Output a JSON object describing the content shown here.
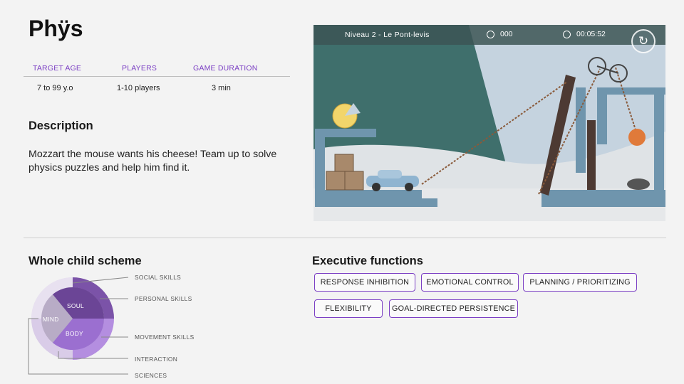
{
  "app": {
    "title": "Phÿs"
  },
  "info": {
    "headers": [
      "TARGET AGE",
      "PLAYERS",
      "GAME DURATION"
    ],
    "values": [
      "7 to 99  y.o",
      "1-10 players",
      "3 min"
    ]
  },
  "description": {
    "heading": "Description",
    "text": "Mozzart the mouse wants his cheese! Team up to solve physics puzzles and help him find it."
  },
  "game": {
    "level": "Niveau 2 - Le Pont-levis",
    "score": "000",
    "timer": "00:05:52",
    "icons": [
      "ball-icon",
      "stopwatch-icon",
      "restart-icon"
    ]
  },
  "whole_child": {
    "heading": "Whole child scheme",
    "center_labels": [
      "SOUL",
      "MIND",
      "BODY"
    ],
    "callouts": [
      "SOCIAL SKILLS",
      "PERSONAL SKILLS",
      "MOVEMENT SKILLS",
      "INTERACTION",
      "SCIENCES"
    ],
    "colors": {
      "soul": "#6b4596",
      "mind": "#b8acc6",
      "body": "#9b6fd0",
      "outer": "#d9cce8"
    }
  },
  "executive": {
    "heading": "Executive functions",
    "tags": [
      "RESPONSE INHIBITION",
      "EMOTIONAL CONTROL",
      "PLANNING / PRIORITIZING",
      "FLEXIBILITY",
      "GOAL-DIRECTED PERSISTENCE"
    ]
  },
  "colors": {
    "accent": "#7b3fc4"
  }
}
